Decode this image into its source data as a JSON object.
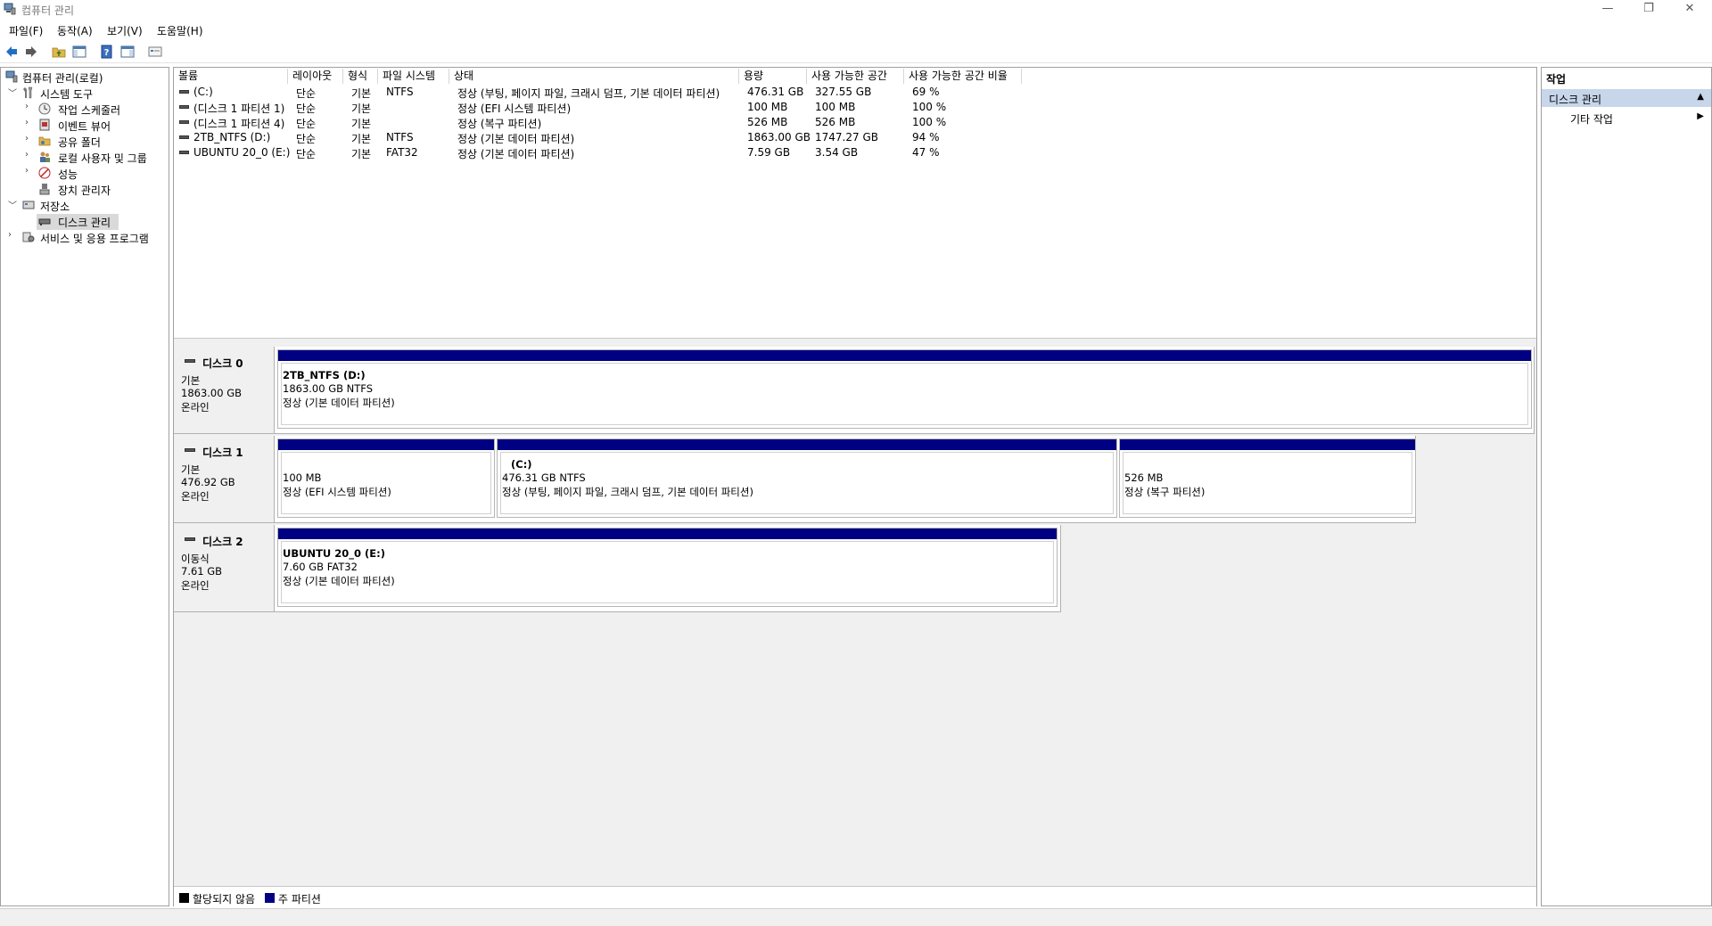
{
  "window": {
    "title": "컴퓨터 관리",
    "minimize": "—",
    "restore": "❐",
    "close": "✕"
  },
  "menu": [
    "파일(F)",
    "동작(A)",
    "보기(V)",
    "도움말(H)"
  ],
  "tree": {
    "root": "컴퓨터 관리(로컬)",
    "system_tools": "시스템 도구",
    "task_scheduler": "작업 스케줄러",
    "event_viewer": "이벤트 뷰어",
    "shared_folders": "공유 폴더",
    "local_users": "로컬 사용자 및 그룹",
    "performance": "성능",
    "device_manager": "장치 관리자",
    "storage": "저장소",
    "disk_management": "디스크 관리",
    "services": "서비스 및 응용 프로그램"
  },
  "volumes": {
    "headers": [
      "볼륨",
      "레이아웃",
      "형식",
      "파일 시스템",
      "상태",
      "용량",
      "사용 가능한 공간",
      "사용 가능한 공간 비율"
    ],
    "rows": [
      [
        "(C:)",
        "단순",
        "기본",
        "NTFS",
        "정상 (부팅, 페이지 파일, 크래시 덤프, 기본 데이터 파티션)",
        "476.31 GB",
        "327.55 GB",
        "69 %"
      ],
      [
        "(디스크 1 파티션 1)",
        "단순",
        "기본",
        "",
        "정상 (EFI 시스템 파티션)",
        "100 MB",
        "100 MB",
        "100 %"
      ],
      [
        "(디스크 1 파티션 4)",
        "단순",
        "기본",
        "",
        "정상 (복구 파티션)",
        "526 MB",
        "526 MB",
        "100 %"
      ],
      [
        "2TB_NTFS (D:)",
        "단순",
        "기본",
        "NTFS",
        "정상 (기본 데이터 파티션)",
        "1863.00 GB",
        "1747.27 GB",
        "94 %"
      ],
      [
        "UBUNTU 20_0 (E:)",
        "단순",
        "기본",
        "FAT32",
        "정상 (기본 데이터 파티션)",
        "7.59 GB",
        "3.54 GB",
        "47 %"
      ]
    ]
  },
  "disks": [
    {
      "name": "디스크 0",
      "type": "기본",
      "size": "1863.00 GB",
      "status": "온라인",
      "partitions": [
        {
          "title": "2TB_NTFS  (D:)",
          "size": "1863.00 GB NTFS",
          "status": "정상 (기본 데이터 파티션)"
        }
      ]
    },
    {
      "name": "디스크 1",
      "type": "기본",
      "size": "476.92 GB",
      "status": "온라인",
      "partitions": [
        {
          "title": "",
          "size": "100 MB",
          "status": "정상 (EFI 시스템 파티션)"
        },
        {
          "title": "(C:)",
          "size": "476.31 GB NTFS",
          "status": "정상 (부팅, 페이지 파일, 크래시 덤프, 기본 데이터 파티션)"
        },
        {
          "title": "",
          "size": "526 MB",
          "status": "정상 (복구 파티션)"
        }
      ]
    },
    {
      "name": "디스크 2",
      "type": "이동식",
      "size": "7.61 GB",
      "status": "온라인",
      "partitions": [
        {
          "title": "UBUNTU 20_0  (E:)",
          "size": "7.60 GB FAT32",
          "status": "정상 (기본 데이터 파티션)"
        }
      ]
    }
  ],
  "legend": {
    "unallocated": "할당되지 않음",
    "primary": "주 파티션",
    "unallocated_color": "#000000",
    "primary_color": "#000082"
  },
  "actions": {
    "header": "작업",
    "section": "디스크 관리",
    "more": "기타 작업"
  }
}
